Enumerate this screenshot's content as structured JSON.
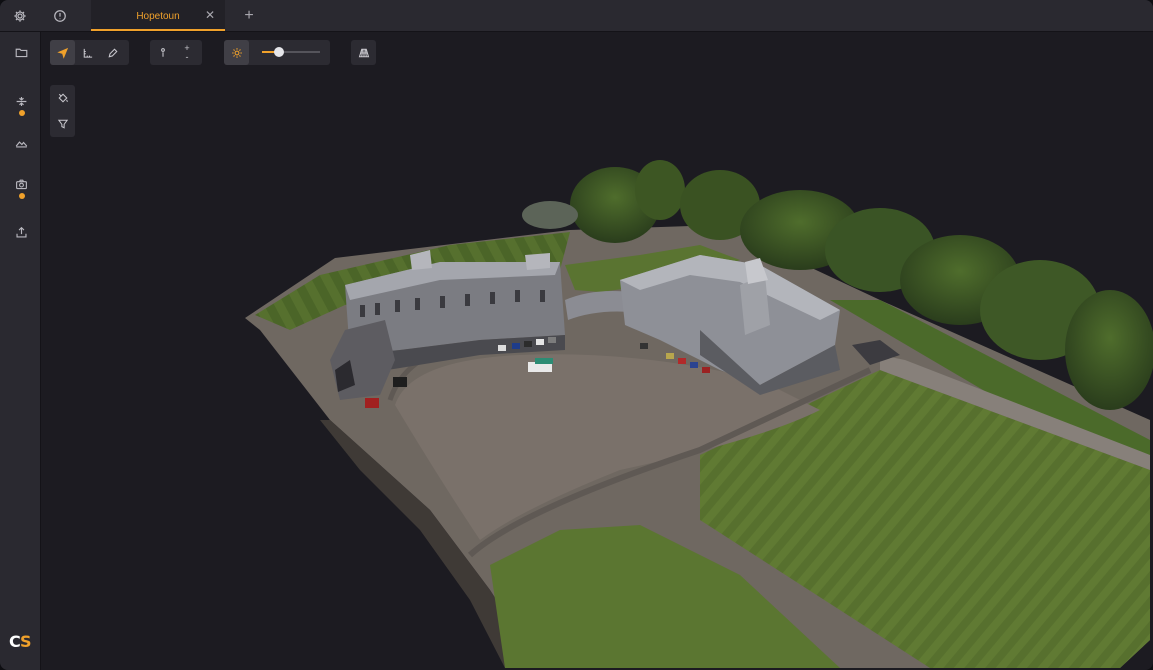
{
  "tabbar": {
    "settings_icon": "gear-icon",
    "info_icon": "info-icon",
    "active_tab": {
      "label": "Hopetoun",
      "close": "✕"
    },
    "add_tab": "+"
  },
  "sidebar": {
    "items": [
      {
        "icon": "folder-icon",
        "has_dot": false
      },
      {
        "icon": "layers-split-icon",
        "has_dot": true
      },
      {
        "icon": "terrain-icon",
        "has_dot": false
      },
      {
        "icon": "camera-icon",
        "has_dot": true
      },
      {
        "icon": "export-icon",
        "has_dot": false
      }
    ],
    "logo": {
      "c": "C",
      "s": "S"
    }
  },
  "toolbar": {
    "navigate": {
      "icon": "navigate-arrow-icon",
      "active": true
    },
    "measure": {
      "icon": "measure-icon",
      "active": false
    },
    "pen": {
      "icon": "pen-icon",
      "active": false
    },
    "point_size": {
      "icon": "point-size-icon",
      "plus": "+",
      "minus": "-"
    },
    "brightness": {
      "icon": "sun-icon",
      "active": true,
      "level": 0.3
    },
    "perspective": {
      "icon": "perspective-grid-icon"
    },
    "color_fill": {
      "icon": "paint-bucket-icon"
    },
    "filter": {
      "icon": "filter-icon"
    }
  },
  "colors": {
    "accent": "#f0a12b",
    "background": "#1c1b21",
    "panel": "#2a2930"
  }
}
